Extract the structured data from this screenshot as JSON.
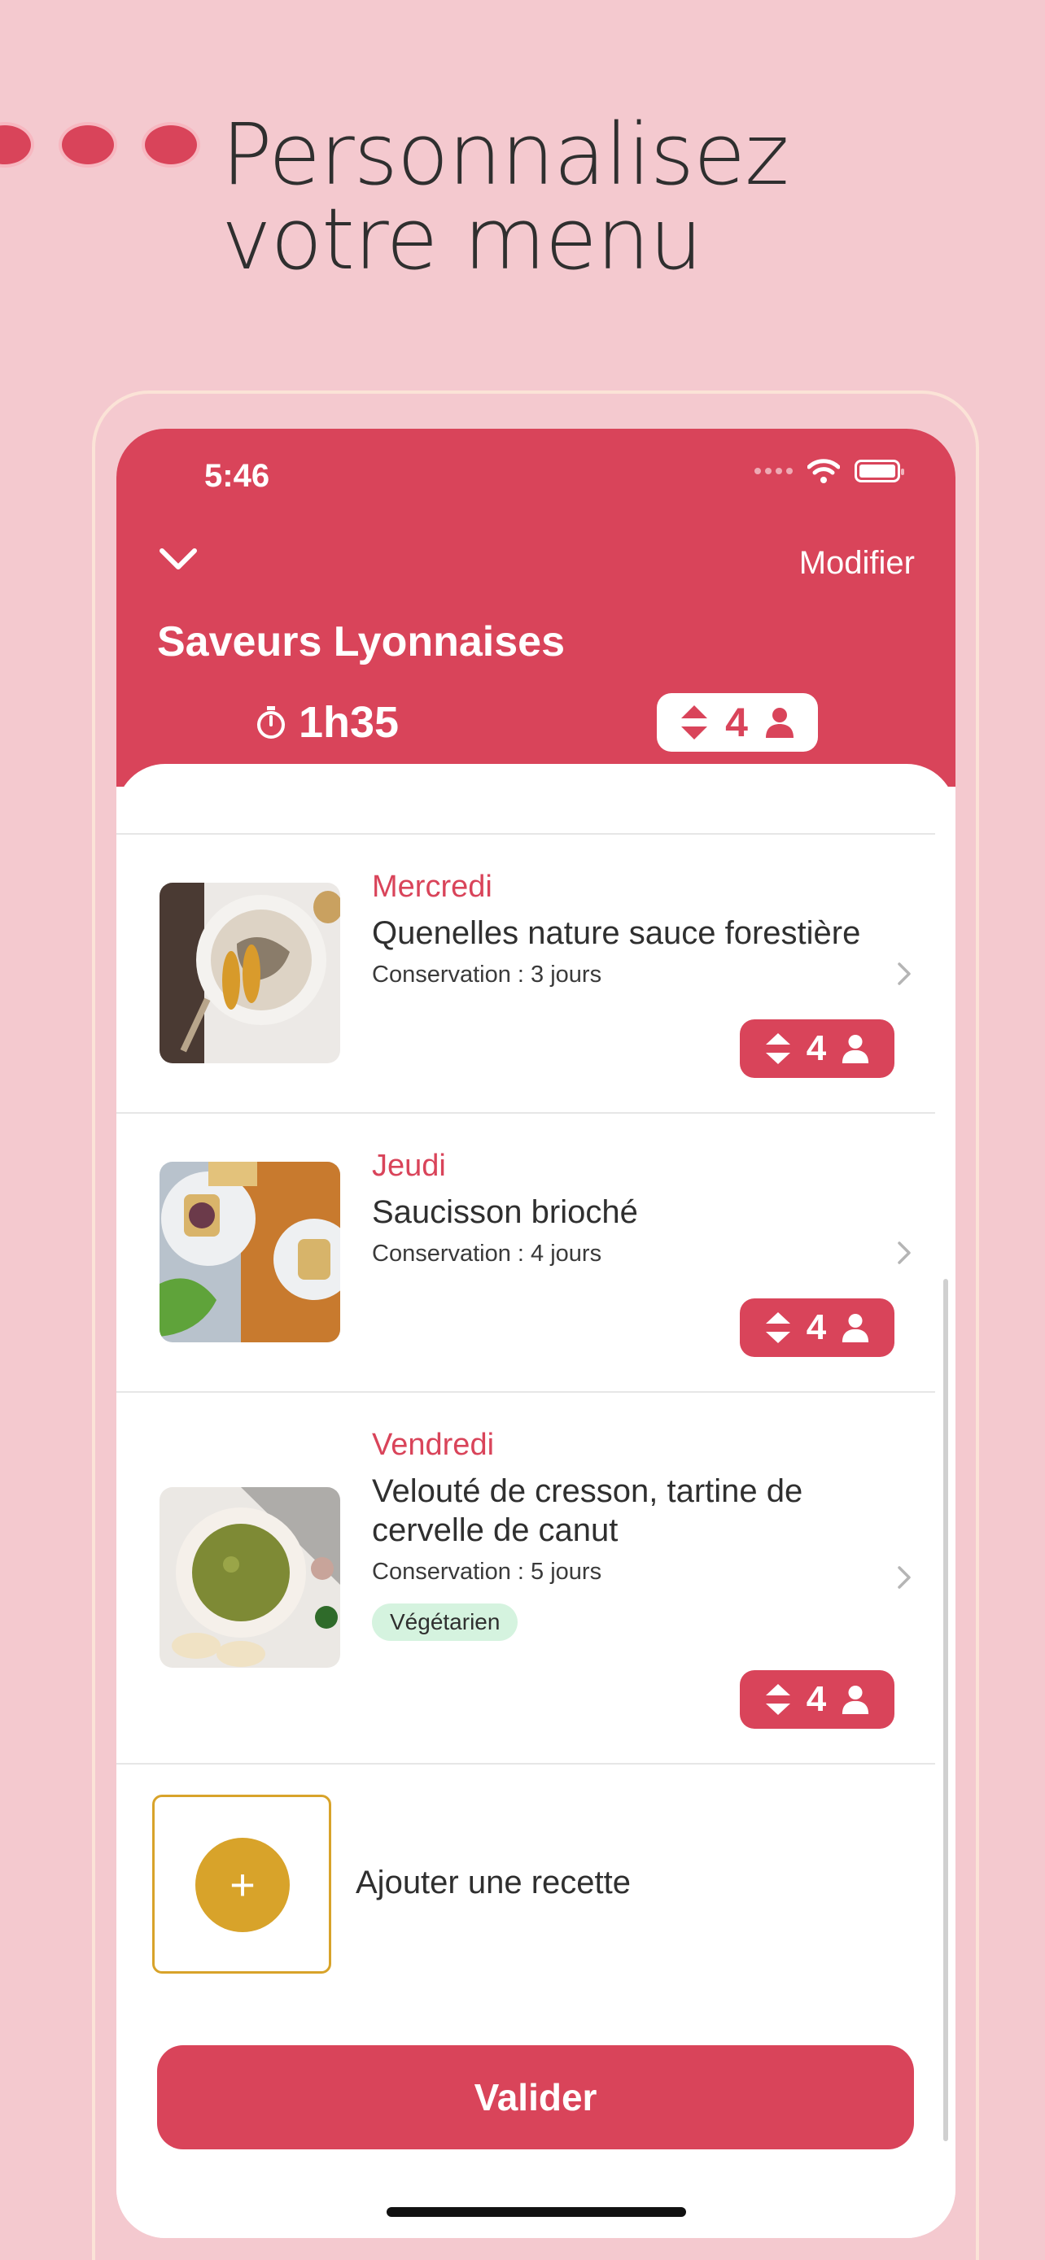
{
  "promo": {
    "headline_line1": "Personnalisez",
    "headline_line2": "votre menu"
  },
  "status_bar": {
    "time": "5:46"
  },
  "header": {
    "edit_label": "Modifier",
    "title": "Saveurs Lyonnaises",
    "duration": "1h35",
    "servings": "4"
  },
  "recipes": [
    {
      "day": "Mercredi",
      "name": "Quenelles nature sauce forestière",
      "conservation": "Conservation : 3 jours",
      "servings": "4",
      "tag": ""
    },
    {
      "day": "Jeudi",
      "name": "Saucisson brioché",
      "conservation": "Conservation : 4 jours",
      "servings": "4",
      "tag": ""
    },
    {
      "day": "Vendredi",
      "name": "Velouté de cresson, tartine de cervelle de canut",
      "conservation": "Conservation : 5 jours",
      "servings": "4",
      "tag": "Végétarien"
    }
  ],
  "add_recipe": {
    "label": "Ajouter une recette",
    "icon": "+"
  },
  "validate_label": "Valider",
  "icons": [
    "chevron-down-icon",
    "timer-icon",
    "sort-icon",
    "person-icon",
    "chevron-right-icon",
    "wifi-icon",
    "battery-icon",
    "plus-icon"
  ],
  "colors": {
    "background": "#f4c9cf",
    "accent": "#d9445a",
    "add_accent": "#d8a32a",
    "tag_bg": "#d5f3df"
  }
}
